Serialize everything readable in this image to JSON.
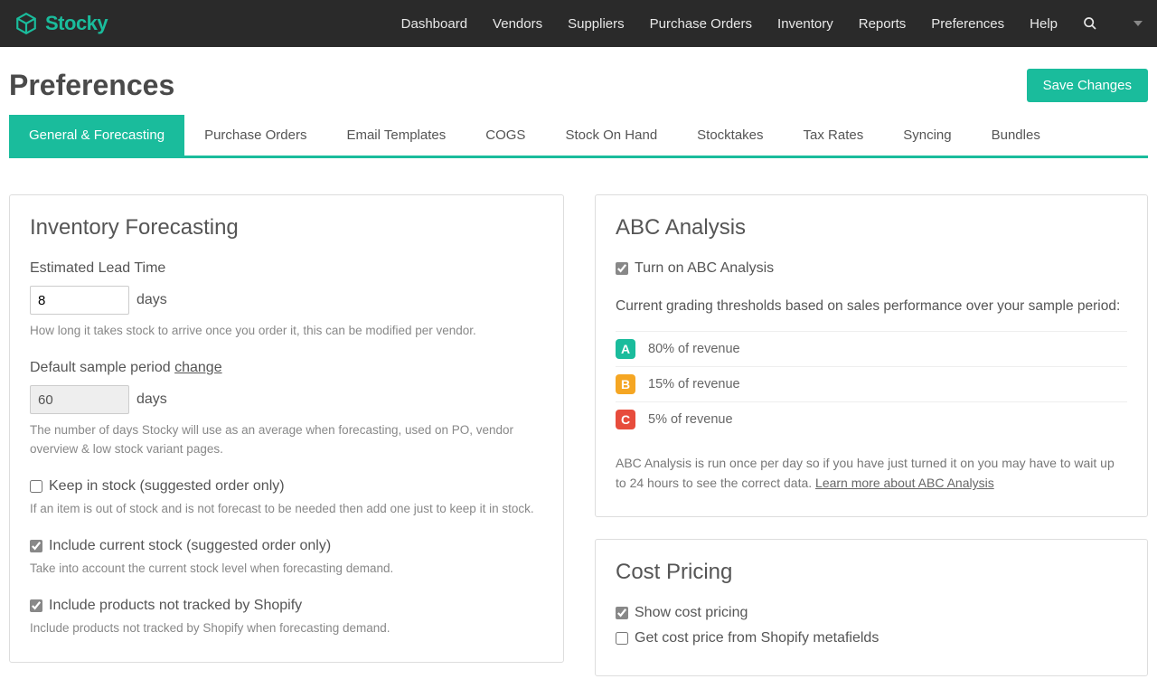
{
  "brand": "Stocky",
  "nav": {
    "items": [
      "Dashboard",
      "Vendors",
      "Suppliers",
      "Purchase Orders",
      "Inventory",
      "Reports",
      "Preferences",
      "Help"
    ]
  },
  "page": {
    "title": "Preferences",
    "save_btn": "Save Changes"
  },
  "tabs": [
    "General & Forecasting",
    "Purchase Orders",
    "Email Templates",
    "COGS",
    "Stock On Hand",
    "Stocktakes",
    "Tax Rates",
    "Syncing",
    "Bundles"
  ],
  "forecasting": {
    "title": "Inventory Forecasting",
    "lead_time_label": "Estimated Lead Time",
    "lead_time_value": "8",
    "lead_time_unit": "days",
    "lead_time_help": "How long it takes stock to arrive once you order it, this can be modified per vendor.",
    "sample_label_prefix": "Default sample period ",
    "sample_change": "change",
    "sample_value": "60",
    "sample_unit": "days",
    "sample_help": "The number of days Stocky will use as an average when forecasting, used on PO, vendor overview & low stock variant pages.",
    "keep_in_stock_label": "Keep in stock (suggested order only)",
    "keep_in_stock_help": "If an item is out of stock and is not forecast to be needed then add one just to keep it in stock.",
    "include_current_label": "Include current stock (suggested order only)",
    "include_current_help": "Take into account the current stock level when forecasting demand.",
    "include_untracked_label": "Include products not tracked by Shopify",
    "include_untracked_help": "Include products not tracked by Shopify when forecasting demand."
  },
  "abc": {
    "title": "ABC Analysis",
    "enable_label": "Turn on ABC Analysis",
    "intro": "Current grading thresholds based on sales performance over your sample period:",
    "grades": [
      {
        "letter": "A",
        "text": "80% of revenue"
      },
      {
        "letter": "B",
        "text": "15% of revenue"
      },
      {
        "letter": "C",
        "text": "5% of revenue"
      }
    ],
    "note_prefix": "ABC Analysis is run once per day so if you have just turned it on you may have to wait up to 24 hours to see the correct data. ",
    "note_link": "Learn more about ABC Analysis"
  },
  "cost": {
    "title": "Cost Pricing",
    "show_label": "Show cost pricing",
    "metafields_label": "Get cost price from Shopify metafields"
  }
}
